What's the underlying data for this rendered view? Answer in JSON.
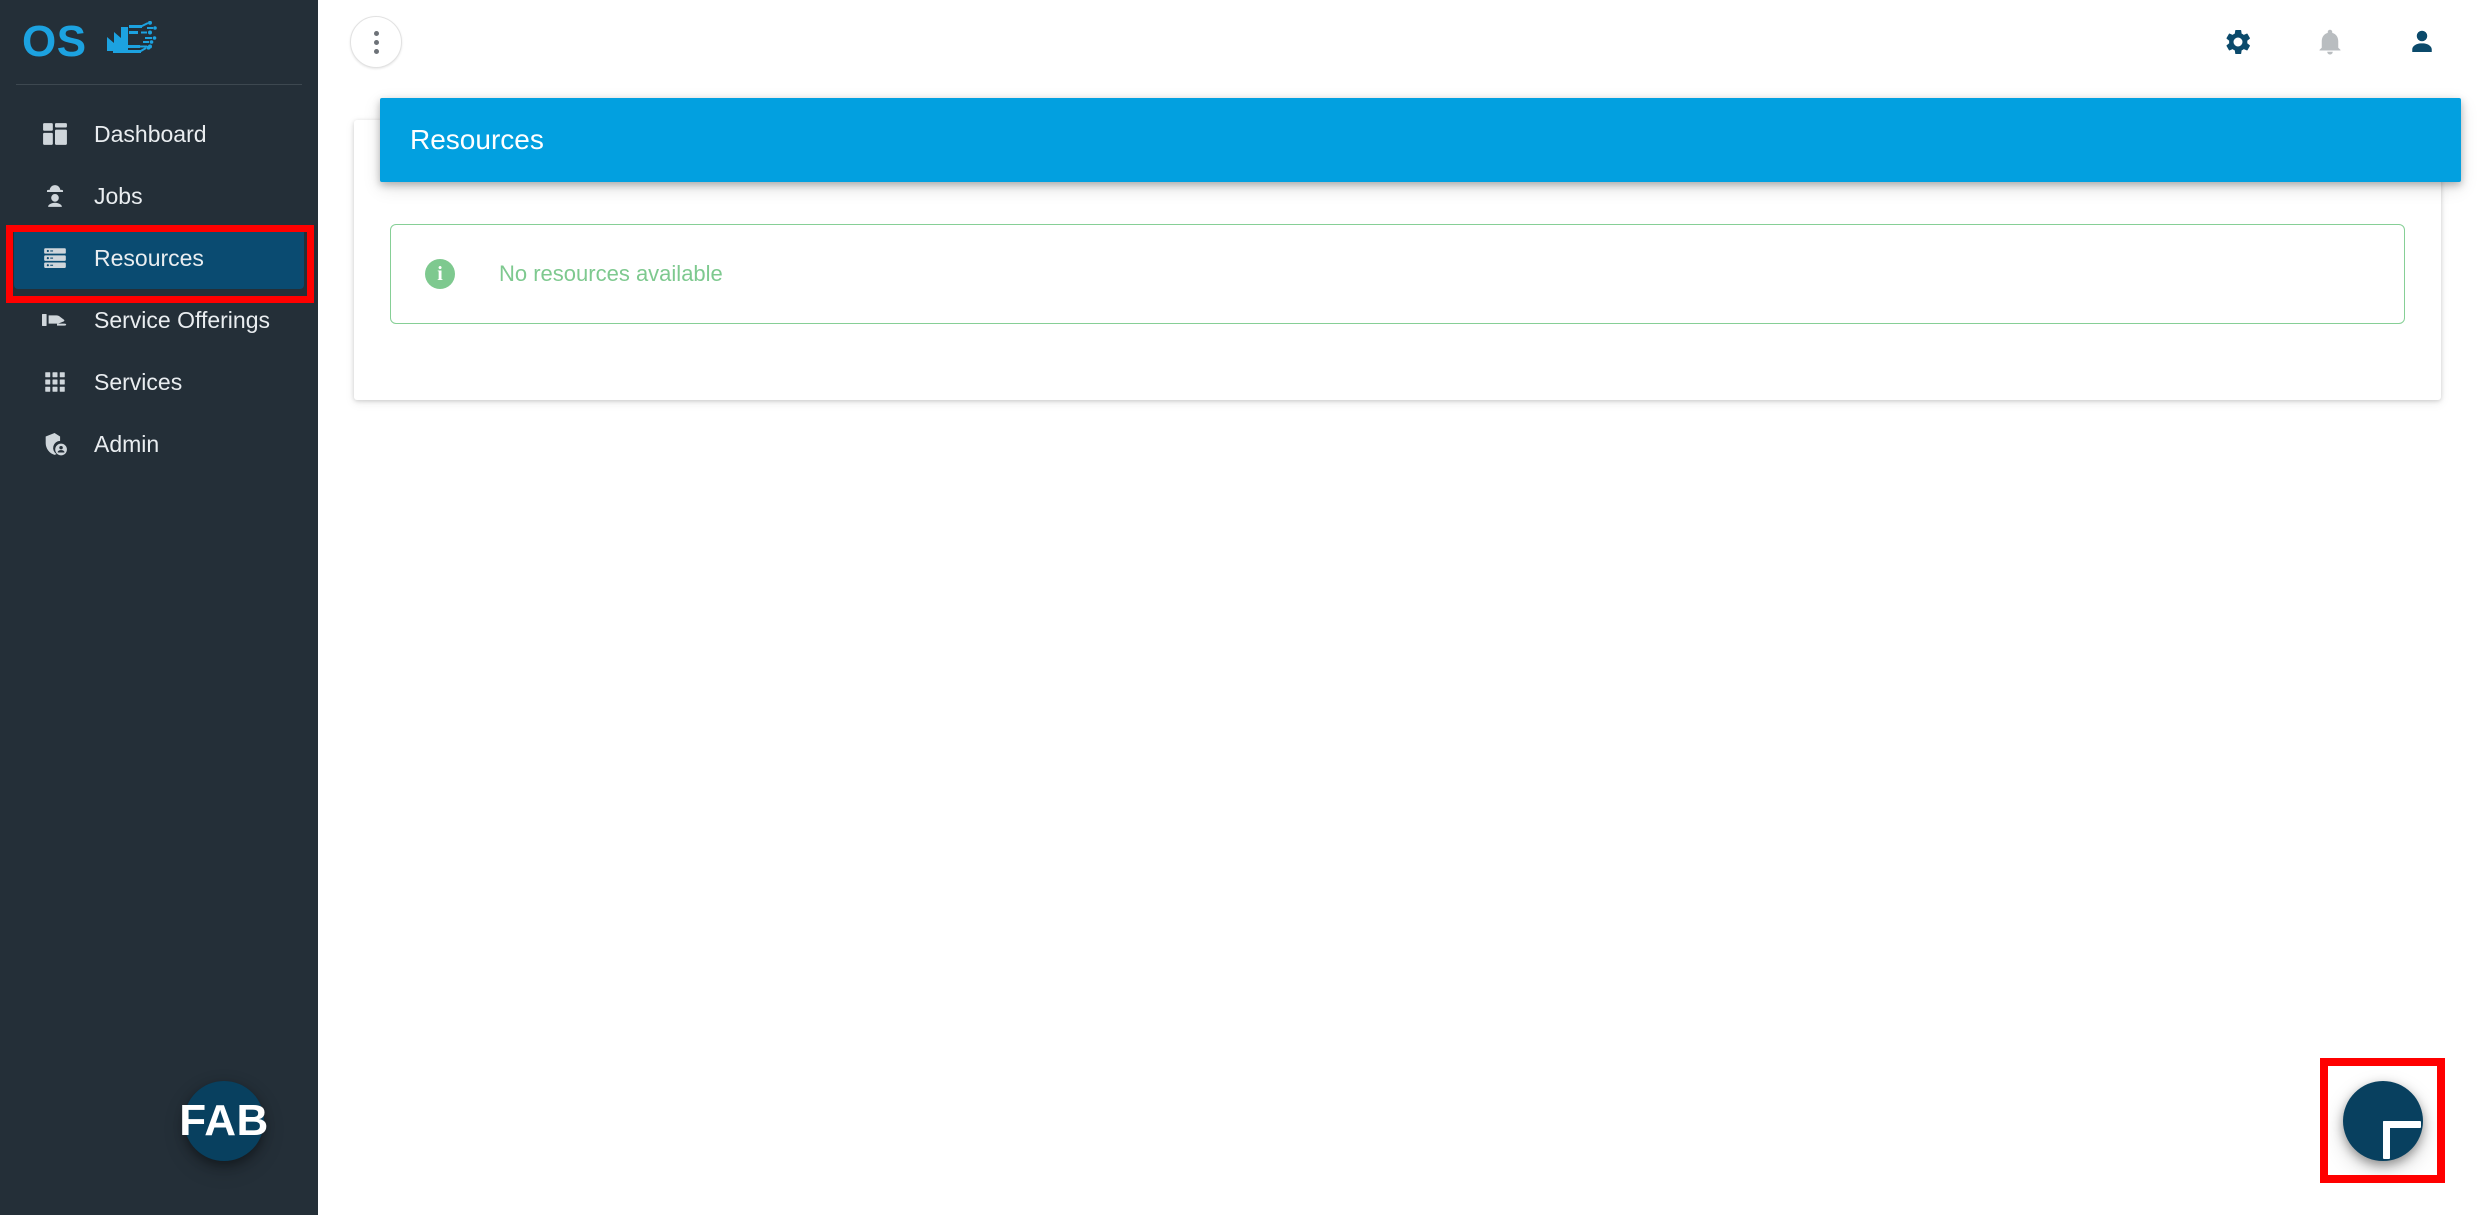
{
  "app": {
    "brand_first": "FAB",
    "brand_second": "OS",
    "brand_logo_icon": "factory-circuit-icon"
  },
  "colors": {
    "sidebar_bg": "#242F38",
    "sidebar_active_bg": "#0A4B71",
    "banner_blue": "#02A0E0",
    "brand_blue": "#1CA2E0",
    "fab_navy": "#08405F",
    "alert_green": "#7EC98F",
    "annotation_red": "#FF0000",
    "header_icon_navy": "#0B4A6B",
    "bell_gray": "#B9BDC0"
  },
  "sidebar": {
    "items": [
      {
        "label": "Dashboard",
        "icon": "dashboard-grid-icon",
        "active": false
      },
      {
        "label": "Jobs",
        "icon": "worker-helmet-icon",
        "active": false
      },
      {
        "label": "Resources",
        "icon": "server-stack-icon",
        "active": true
      },
      {
        "label": "Service Offerings",
        "icon": "hand-offering-icon",
        "active": false
      },
      {
        "label": "Services",
        "icon": "apps-dots-grid-icon",
        "active": false
      },
      {
        "label": "Admin",
        "icon": "shield-account-icon",
        "active": false
      }
    ]
  },
  "topbar": {
    "menu_button": "more-options-menu",
    "actions": [
      {
        "name": "settings-gear-icon",
        "title": "Settings"
      },
      {
        "name": "notifications-bell-icon",
        "title": "Notifications"
      },
      {
        "name": "account-person-icon",
        "title": "Account"
      }
    ]
  },
  "page": {
    "banner_title": "Resources"
  },
  "alert": {
    "icon": "info-circle-icon",
    "icon_glyph": "i",
    "message": "No resources available"
  },
  "fab": {
    "name": "add-resource-button",
    "icon": "plus-icon",
    "title": "Add"
  },
  "annotations": [
    {
      "name": "annotation-sidebar-resources",
      "target": "Resources"
    },
    {
      "name": "annotation-add-button",
      "target": "Add"
    }
  ]
}
